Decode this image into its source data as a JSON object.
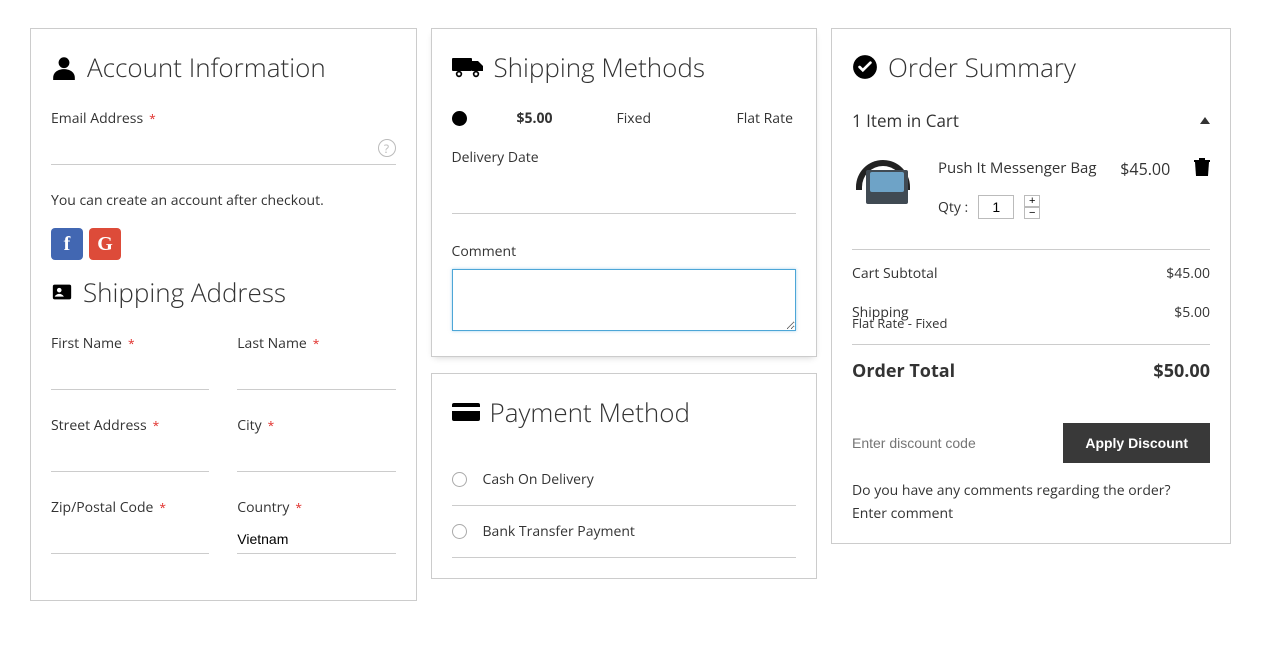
{
  "account": {
    "title": "Account Information",
    "email_label": "Email Address",
    "note": "You can create an account after checkout."
  },
  "address": {
    "title": "Shipping Address",
    "first_name": "First Name",
    "last_name": "Last Name",
    "street": "Street Address",
    "city": "City",
    "zip": "Zip/Postal Code",
    "country": "Country",
    "country_value": "Vietnam"
  },
  "shipping": {
    "title": "Shipping Methods",
    "price": "$5.00",
    "method": "Fixed",
    "carrier": "Flat Rate",
    "delivery_date_label": "Delivery Date",
    "comment_label": "Comment"
  },
  "payment": {
    "title": "Payment Method",
    "options": [
      "Cash On Delivery",
      "Bank Transfer Payment"
    ]
  },
  "summary": {
    "title": "Order Summary",
    "items_label": "1 Item in Cart",
    "product": {
      "name": "Push It Messenger Bag",
      "price": "$45.00",
      "qty_label": "Qty :",
      "qty": "1"
    },
    "subtotal_label": "Cart Subtotal",
    "subtotal": "$45.00",
    "shipping_label": "Shipping",
    "shipping_sub": "Flat Rate - Fixed",
    "shipping_val": "$5.00",
    "total_label": "Order Total",
    "total": "$50.00",
    "discount_placeholder": "Enter discount code",
    "apply": "Apply Discount",
    "order_comment_q": "Do you have any comments regarding the order?",
    "order_comment_hint": "Enter comment"
  }
}
